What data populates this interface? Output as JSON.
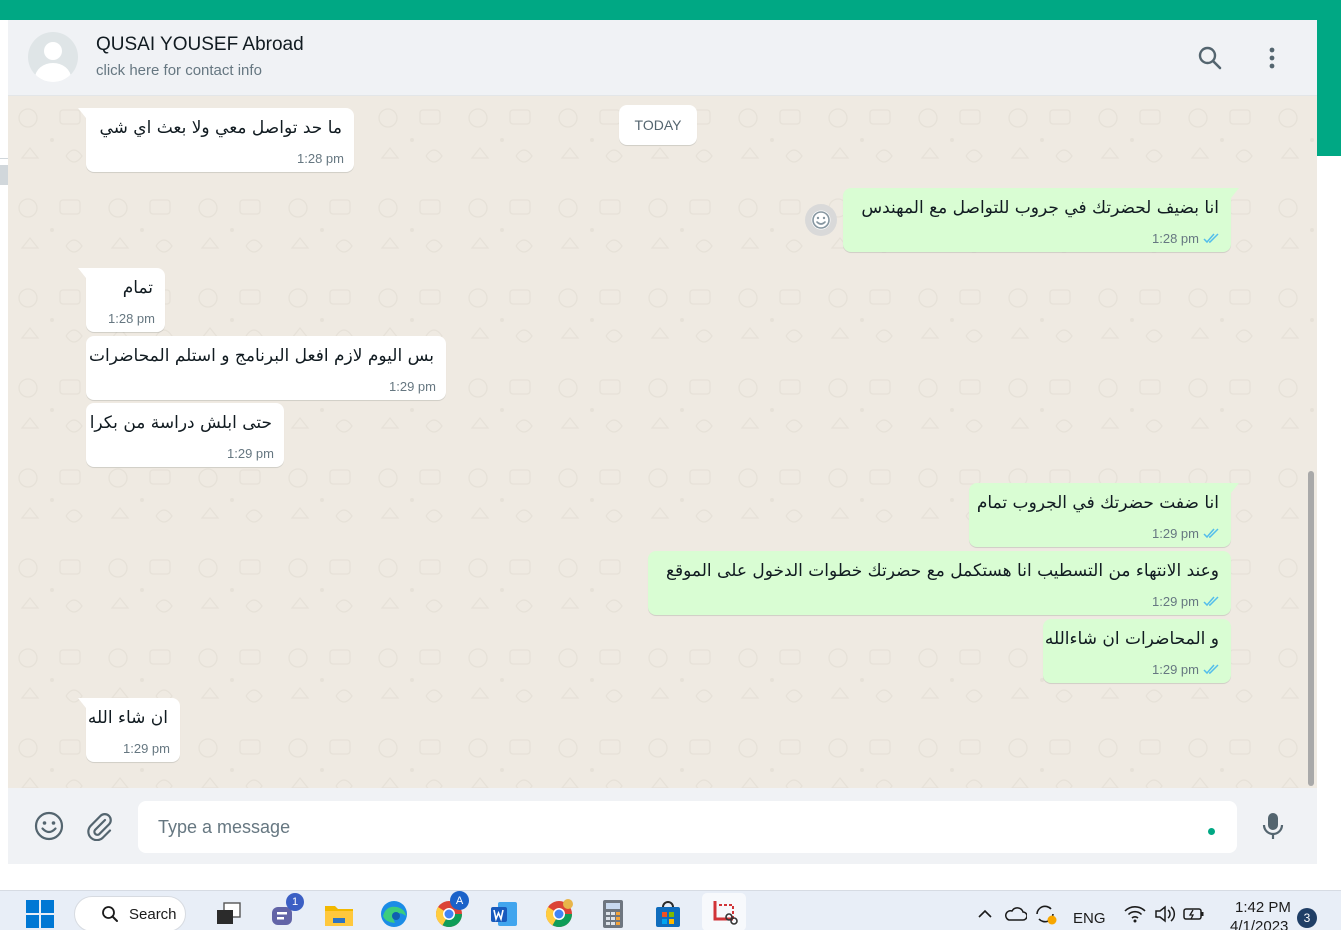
{
  "header": {
    "contact_name": "QUSAI YOUSEF Abroad",
    "contact_subtitle": "click here for contact info"
  },
  "chat": {
    "date_chip": "TODAY",
    "messages": [
      {
        "direction": "in",
        "text": "ما حد تواصل معي ولا بعث اي شي",
        "time": "1:28 pm"
      },
      {
        "direction": "out",
        "text": "انا بضيف لحضرتك في جروب للتواصل مع المهندس",
        "time": "1:28 pm",
        "status": "read"
      },
      {
        "direction": "in",
        "text": "تمام",
        "time": "1:28 pm"
      },
      {
        "direction": "in",
        "text": "بس اليوم لازم افعل البرنامج و استلم المحاضرات",
        "time": "1:29 pm"
      },
      {
        "direction": "in",
        "text": "حتى ابلش دراسة من بكرا",
        "time": "1:29 pm"
      },
      {
        "direction": "out",
        "text": "انا ضفت حضرتك في الجروب تمام",
        "time": "1:29 pm",
        "status": "read"
      },
      {
        "direction": "out",
        "text": "وعند الانتهاء من التسطيب انا هستكمل مع حضرتك خطوات الدخول على الموقع",
        "time": "1:29 pm",
        "status": "read"
      },
      {
        "direction": "out",
        "text": "و المحاضرات ان شاءالله",
        "time": "1:29 pm",
        "status": "read"
      },
      {
        "direction": "in",
        "text": "ان شاء الله",
        "time": "1:29 pm"
      }
    ]
  },
  "composer": {
    "placeholder": "Type a message"
  },
  "taskbar": {
    "search_label": "Search",
    "teams_badge": "1",
    "chrome_profile_badge": "A",
    "language": "ENG",
    "time": "1:42 PM",
    "date": "4/1/2023",
    "notification_count": "3"
  },
  "colors": {
    "accent": "#00a884",
    "incoming_bubble": "#ffffff",
    "outgoing_bubble": "#d9fdd3",
    "read_ticks": "#53bdeb",
    "chat_background": "#efeae2"
  }
}
